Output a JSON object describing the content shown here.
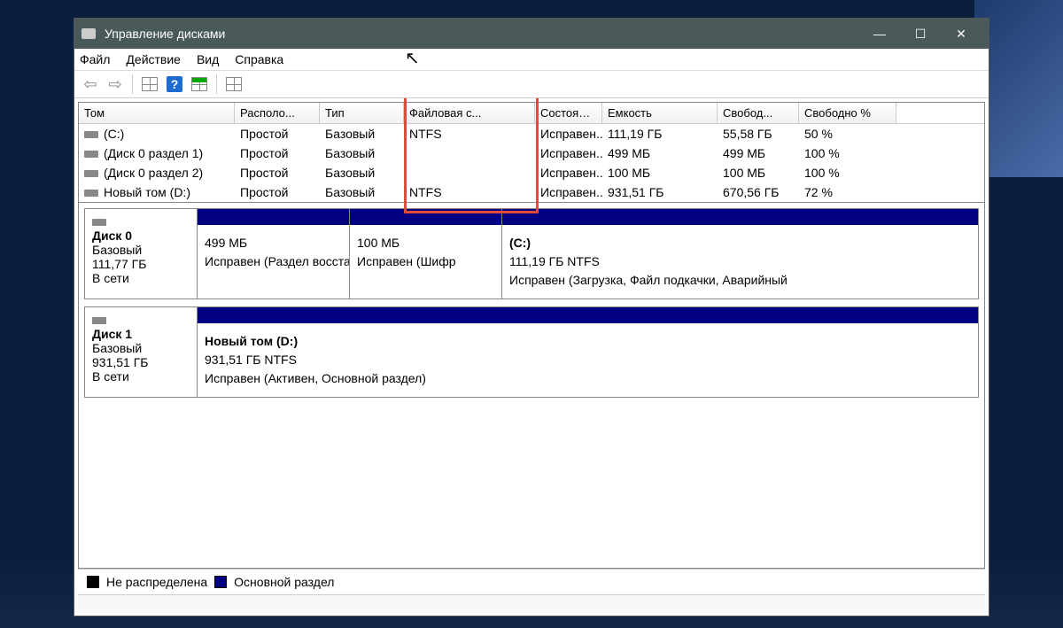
{
  "title": "Управление дисками",
  "menu": {
    "file": "Файл",
    "action": "Действие",
    "view": "Вид",
    "help": "Справка"
  },
  "columns": {
    "volume": "Том",
    "layout": "Располо...",
    "type": "Тип",
    "fs": "Файловая с...",
    "status": "Состояние",
    "capacity": "Емкость",
    "free": "Свобод...",
    "free_pct": "Свободно %"
  },
  "volumes": [
    {
      "name": "(C:)",
      "layout": "Простой",
      "type": "Базовый",
      "fs": "NTFS",
      "status": "Исправен...",
      "capacity": "111,19 ГБ",
      "free": "55,58 ГБ",
      "pct": "50 %"
    },
    {
      "name": "(Диск 0 раздел 1)",
      "layout": "Простой",
      "type": "Базовый",
      "fs": "",
      "status": "Исправен...",
      "capacity": "499 МБ",
      "free": "499 МБ",
      "pct": "100 %"
    },
    {
      "name": "(Диск 0 раздел 2)",
      "layout": "Простой",
      "type": "Базовый",
      "fs": "",
      "status": "Исправен...",
      "capacity": "100 МБ",
      "free": "100 МБ",
      "pct": "100 %"
    },
    {
      "name": "Новый том (D:)",
      "layout": "Простой",
      "type": "Базовый",
      "fs": "NTFS",
      "status": "Исправен...",
      "capacity": "931,51 ГБ",
      "free": "670,56 ГБ",
      "pct": "72 %"
    }
  ],
  "disks": [
    {
      "name": "Диск 0",
      "type": "Базовый",
      "size": "111,77 ГБ",
      "status": "В сети",
      "partitions": [
        {
          "title": "",
          "size": "499 МБ",
          "info": "Исправен (Раздел восста",
          "width": 172
        },
        {
          "title": "",
          "size": "100 МБ",
          "info": "Исправен (Шифр",
          "width": 172
        },
        {
          "title": "(C:)",
          "size": "111,19 ГБ NTFS",
          "info": "Исправен (Загрузка, Файл подкачки, Аварийный",
          "width": 0
        }
      ]
    },
    {
      "name": "Диск 1",
      "type": "Базовый",
      "size": "931,51 ГБ",
      "status": "В сети",
      "partitions": [
        {
          "title": "Новый том  (D:)",
          "size": "931,51 ГБ NTFS",
          "info": "Исправен (Активен, Основной раздел)",
          "width": 0
        }
      ]
    }
  ],
  "legend": {
    "unallocated": "Не распределена",
    "primary": "Основной раздел"
  },
  "colors": {
    "primary": "#000080",
    "unallocated": "#000000",
    "highlight": "#e44a3c"
  }
}
